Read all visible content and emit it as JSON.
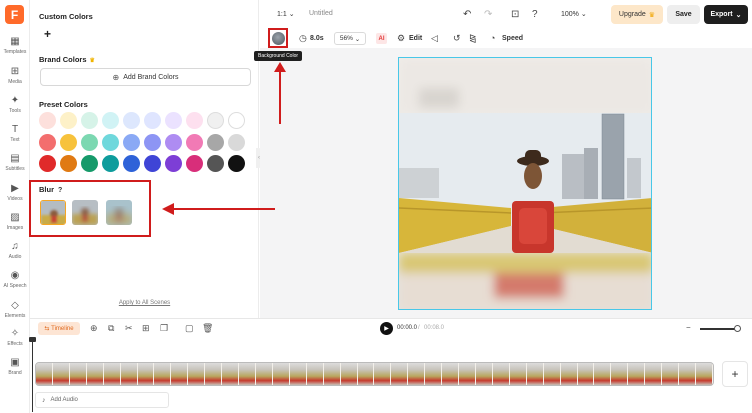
{
  "app": {
    "logo_letter": "F"
  },
  "rail": [
    {
      "label": "Templates",
      "icon": "templates-icon",
      "glyph": "▦"
    },
    {
      "label": "Media",
      "icon": "media-icon",
      "glyph": "⊞"
    },
    {
      "label": "Tools",
      "icon": "ai-tools-icon",
      "glyph": "✦"
    },
    {
      "label": "Text",
      "icon": "text-icon",
      "glyph": "T"
    },
    {
      "label": "Subtitles",
      "icon": "subtitles-icon",
      "glyph": "▤"
    },
    {
      "label": "Videos",
      "icon": "videos-icon",
      "glyph": "▶"
    },
    {
      "label": "Images",
      "icon": "images-icon",
      "glyph": "▨"
    },
    {
      "label": "Audio",
      "icon": "audio-icon",
      "glyph": "♫"
    },
    {
      "label": "AI Speech",
      "icon": "ai-speech-icon",
      "glyph": "◉"
    },
    {
      "label": "Elements",
      "icon": "elements-icon",
      "glyph": "◇"
    },
    {
      "label": "Effects",
      "icon": "effects-icon",
      "glyph": "✧"
    },
    {
      "label": "Brand",
      "icon": "brand-icon",
      "glyph": "▣"
    }
  ],
  "panel": {
    "custom_colors": "Custom Colors",
    "add_custom": "+",
    "brand_colors": "Brand Colors",
    "add_brand_colors": "Add Brand Colors",
    "preset_colors": "Preset Colors",
    "preset_rows": [
      [
        "#fde0dc",
        "#fdf1c8",
        "#d6f3e8",
        "#d1f3f5",
        "#dde7fd",
        "#dfe5ff",
        "#ebe2ff",
        "#fde0ef",
        "#f0f0f0",
        "#ffffff"
      ],
      [
        "#f36e6e",
        "#f7c23c",
        "#7cd8b1",
        "#6fd8dc",
        "#8aa9f5",
        "#8d95f4",
        "#ae8cf2",
        "#f17ab5",
        "#a7a7a7",
        "#d9d9d9"
      ],
      [
        "#e02a2a",
        "#e07a13",
        "#169a6a",
        "#0e9c9c",
        "#2e62d8",
        "#3f45d6",
        "#7d3ed6",
        "#d82e7a",
        "#555555",
        "#111111"
      ]
    ],
    "blur": "Blur",
    "blur_help": "?",
    "apply_all": "Apply to All Scenes"
  },
  "topbar": {
    "ratio": "1:1",
    "title": "Untitled",
    "zoom": "100%",
    "upgrade": "Upgrade",
    "save": "Save",
    "export": "Export"
  },
  "toolbar": {
    "duration": "8.0s",
    "scale": "56%",
    "ai_label": "AI",
    "edit": "Edit",
    "speed": "Speed",
    "tooltip": "Background Color"
  },
  "timeline": {
    "label": "Timeline",
    "current_time": "00:00.0",
    "separator": "/",
    "total_time": "00:08.0",
    "add_audio": "Add Audio",
    "add_track": "+"
  }
}
